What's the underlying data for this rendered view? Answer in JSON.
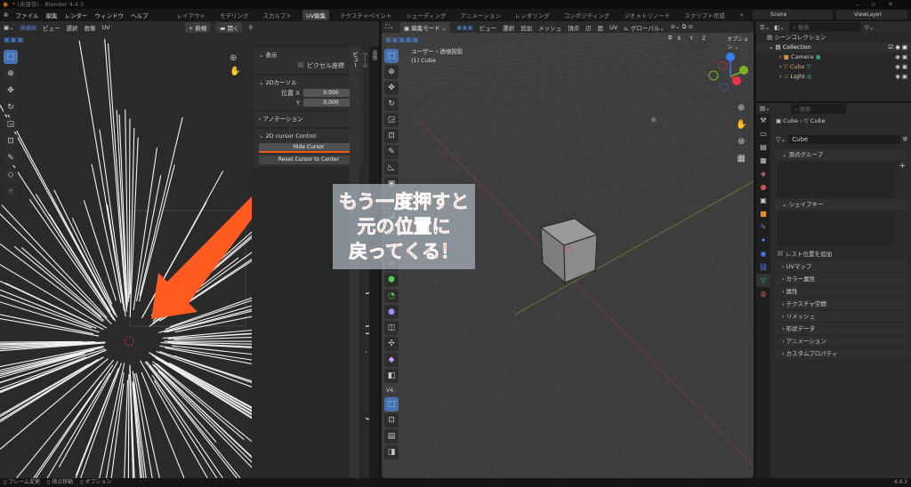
{
  "window": {
    "title": "* (未保存) - Blender 4.4.3"
  },
  "menu": [
    "ファイル",
    "編集",
    "レンダー",
    "ウィンドウ",
    "ヘルプ"
  ],
  "workspaces": [
    "レイアウト",
    "モデリング",
    "スカルプト",
    "UV編集",
    "テクスチャペイント",
    "シェーディング",
    "アニメーション",
    "レンダリング",
    "コンポジティング",
    "ジオメトリノード",
    "スクリプト作成"
  ],
  "active_workspace": "UV編集",
  "add_workspace": "+",
  "scene": {
    "label": "Scene",
    "viewlayer": "ViewLayer"
  },
  "uv_editor": {
    "header": [
      "ビュー",
      "選択",
      "画像",
      "UV"
    ],
    "new_label": "新規",
    "open_label": "開く",
    "sidebar": {
      "display": {
        "title": "表示",
        "pixel_coords": "ピクセル座標"
      },
      "cursor": {
        "title": "2Dカーソル",
        "pos_x_label": "位置 X",
        "pos_y_label": "Y",
        "x": "0.000",
        "y": "0.000"
      },
      "annotation": {
        "title": "アノテーション"
      },
      "control": {
        "title": "2D cursor Control",
        "hide": "Hide Cursor",
        "reset": "Reset Cursor to Center"
      },
      "tabs": [
        "画像",
        "ツール",
        "ビュー"
      ]
    }
  },
  "viewport": {
    "mode": "編集モード",
    "header": [
      "ビュー",
      "選択",
      "追加",
      "メッシュ",
      "頂点",
      "辺",
      "面",
      "UV"
    ],
    "orientation": "グローバル",
    "axes": [
      "X",
      "Y",
      "Z"
    ],
    "options": "オプション",
    "view_name": "ユーザー・透視投影",
    "object_name": "(1) Cube",
    "toolbar_collapse": "V4."
  },
  "annotation_overlay": {
    "lines": [
      "もう一度押すと",
      "元の位置に",
      "戻ってくる！"
    ],
    "color": "#ff5a1f"
  },
  "outliner": {
    "search_placeholder": "検索",
    "root": "シーンコレクション",
    "collection": "Collection",
    "items": [
      {
        "name": "Camera",
        "color": "#d8d8d8"
      },
      {
        "name": "Cube",
        "color": "#f0a030"
      },
      {
        "name": "Light",
        "color": "#d8d8d8"
      }
    ]
  },
  "properties": {
    "search_placeholder": "検索",
    "breadcrumb": [
      "Cube",
      "Cube"
    ],
    "mesh_name": "Cube",
    "vertex_groups": "頂点グループ",
    "shape_keys": "シェイプキー",
    "rest_position": "レスト位置を追加",
    "collapsed": [
      "UVマップ",
      "カラー属性",
      "属性",
      "テクスチャ空間",
      "リメッシュ",
      "形状データ",
      "アニメーション",
      "カスタムプロパティ"
    ]
  },
  "statusbar": {
    "items": [
      "フレーム変更",
      "視点移動",
      "オプション"
    ],
    "version": "4.4.3"
  }
}
